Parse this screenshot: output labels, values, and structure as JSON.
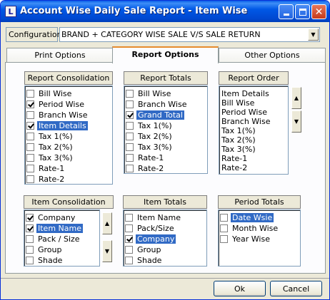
{
  "window": {
    "title": "Account Wise Daily Sale Report - Item Wise",
    "icon_letter": "L"
  },
  "configuration": {
    "label": "Configuration",
    "value": "BRAND + CATEGORY WISE SALE V/S SALE RETURN"
  },
  "tabs": [
    {
      "label": "Print Options",
      "active": false
    },
    {
      "label": "Report Options",
      "active": true
    },
    {
      "label": "Other Options",
      "active": false
    }
  ],
  "report_consolidation": {
    "title": "Report Consolidation",
    "items": [
      {
        "label": "Bill Wise",
        "checked": false,
        "selected": false
      },
      {
        "label": "Period Wise",
        "checked": true,
        "selected": false
      },
      {
        "label": "Branch Wise",
        "checked": false,
        "selected": false
      },
      {
        "label": "Item Details",
        "checked": true,
        "selected": true
      },
      {
        "label": "Tax 1(%)",
        "checked": false,
        "selected": false
      },
      {
        "label": "Tax 2(%)",
        "checked": false,
        "selected": false
      },
      {
        "label": "Tax 3(%)",
        "checked": false,
        "selected": false
      },
      {
        "label": "Rate-1",
        "checked": false,
        "selected": false
      },
      {
        "label": "Rate-2",
        "checked": false,
        "selected": false
      }
    ]
  },
  "report_totals": {
    "title": "Report Totals",
    "items": [
      {
        "label": "Bill Wise",
        "checked": false,
        "selected": false
      },
      {
        "label": "Branch Wise",
        "checked": false,
        "selected": false
      },
      {
        "label": "Grand Total",
        "checked": true,
        "selected": true
      },
      {
        "label": "Tax 1(%)",
        "checked": false,
        "selected": false
      },
      {
        "label": "Tax 2(%)",
        "checked": false,
        "selected": false
      },
      {
        "label": "Tax 3(%)",
        "checked": false,
        "selected": false
      },
      {
        "label": "Rate-1",
        "checked": false,
        "selected": false
      },
      {
        "label": "Rate-2",
        "checked": false,
        "selected": false
      }
    ]
  },
  "report_order": {
    "title": "Report Order",
    "items": [
      "Item Details",
      "Bill Wise",
      "Period Wise",
      "Branch Wise",
      "Tax 1(%)",
      "Tax 2(%)",
      "Tax 3(%)",
      "Rate-1",
      "Rate-2"
    ]
  },
  "item_consolidation": {
    "title": "Item Consolidation",
    "items": [
      {
        "label": "Company",
        "checked": true,
        "selected": false
      },
      {
        "label": "Item Name",
        "checked": true,
        "selected": true
      },
      {
        "label": "Pack / Size",
        "checked": false,
        "selected": false
      },
      {
        "label": "Group",
        "checked": false,
        "selected": false
      },
      {
        "label": "Shade",
        "checked": false,
        "selected": false
      }
    ]
  },
  "item_totals": {
    "title": "Item Totals",
    "items": [
      {
        "label": "Item Name",
        "checked": false,
        "selected": false
      },
      {
        "label": "Pack/Size",
        "checked": false,
        "selected": false
      },
      {
        "label": "Company",
        "checked": true,
        "selected": true
      },
      {
        "label": "Group",
        "checked": false,
        "selected": false
      },
      {
        "label": "Shade",
        "checked": false,
        "selected": false
      }
    ]
  },
  "period_totals": {
    "title": "Period Totals",
    "items": [
      {
        "label": "Date Wsie",
        "checked": false,
        "selected": true
      },
      {
        "label": "Month Wise",
        "checked": false,
        "selected": false
      },
      {
        "label": "Year Wise",
        "checked": false,
        "selected": false
      }
    ]
  },
  "buttons": {
    "ok": "Ok",
    "cancel": "Cancel"
  },
  "colors": {
    "title_bar": "#0054e3",
    "selection": "#316ac5",
    "active_tab_accent": "#e68b2c",
    "dialog_face": "#ece9d8"
  }
}
